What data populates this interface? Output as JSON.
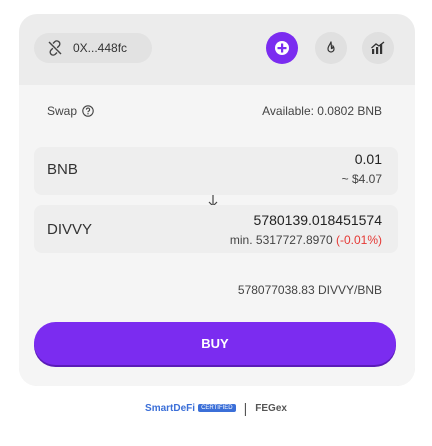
{
  "wallet": {
    "address": "0X...448fc"
  },
  "swap": {
    "label": "Swap",
    "available": "Available: 0.0802 BNB",
    "from_token": "BNB",
    "from_amount": "0.01",
    "from_value": "~ $4.07",
    "to_token": "DIVVY",
    "to_amount": "5780139.018451574",
    "min_prefix": "min. 5317727.8970 ",
    "min_pct": "(-0.01%)",
    "rate": "578077038.83 DIVVY/BNB"
  },
  "buy_label": "BUY",
  "footer": {
    "brand": "SmartDeFi",
    "badge": "CERTIFIED",
    "separator": "|",
    "partner": "FEGex"
  },
  "colors": {
    "accent": "#7b2cf0",
    "negative": "#e53935",
    "brand": "#3b6fd8"
  }
}
